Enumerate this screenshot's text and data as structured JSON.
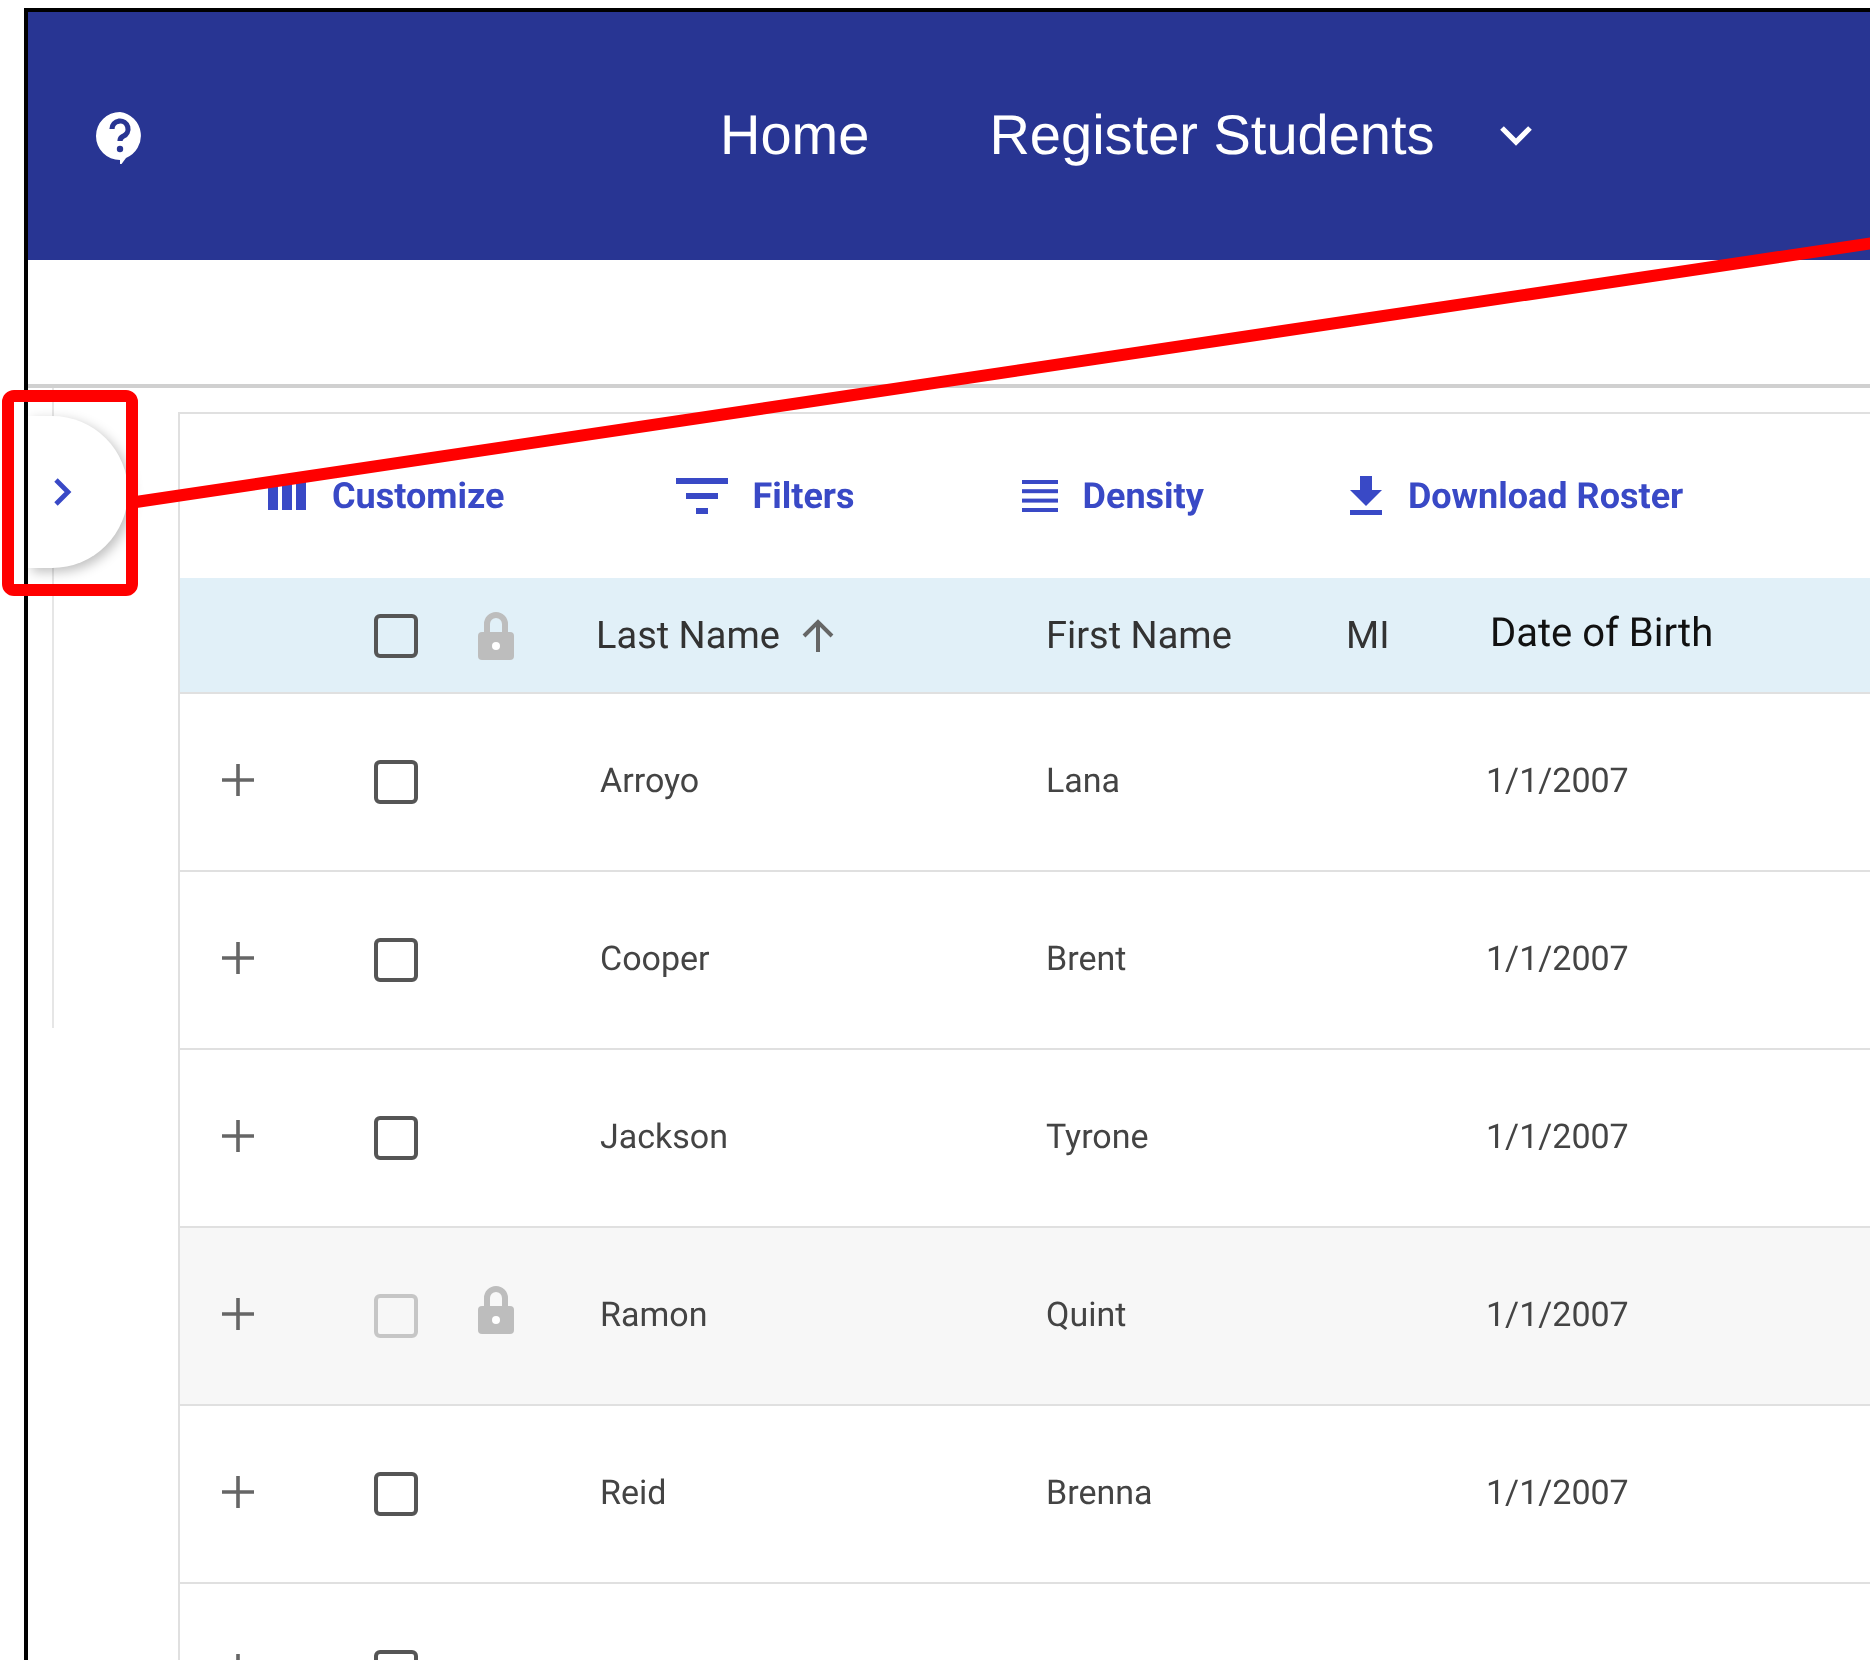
{
  "header": {
    "nav": [
      {
        "label": "Home",
        "kind": "link"
      },
      {
        "label": "Register Students",
        "kind": "dropdown"
      }
    ]
  },
  "sidebar_toggle": {
    "expanded": false
  },
  "toolbar": [
    {
      "label": "Customize",
      "kind": "columns"
    },
    {
      "label": "Filters",
      "kind": "filter"
    },
    {
      "label": "Density",
      "kind": "density"
    },
    {
      "label": "Download Roster",
      "kind": "download"
    }
  ],
  "table": {
    "select_all": {
      "checked": false
    },
    "columns": [
      {
        "label": "Last Name",
        "sorted_ascending": true
      },
      {
        "label": "First Name",
        "sorted_ascending": false
      },
      {
        "label": "MI",
        "sorted_ascending": false
      },
      {
        "label": "Date of Birth",
        "sorted_ascending": false
      }
    ],
    "rows": [
      {
        "last_name": "Arroyo",
        "first_name": "Lana",
        "date_of_birth": "1/1/2007",
        "locked": false,
        "checked": false
      },
      {
        "last_name": "Cooper",
        "first_name": "Brent",
        "date_of_birth": "1/1/2007",
        "locked": false,
        "checked": false
      },
      {
        "last_name": "Jackson",
        "first_name": "Tyrone",
        "date_of_birth": "1/1/2007",
        "locked": false,
        "checked": false
      },
      {
        "last_name": "Ramon",
        "first_name": "Quint",
        "date_of_birth": "1/1/2007",
        "locked": true,
        "checked": false
      },
      {
        "last_name": "Reid",
        "first_name": "Brenna",
        "date_of_birth": "1/1/2007",
        "locked": false,
        "checked": false
      },
      {
        "locked": false,
        "checked": false
      }
    ]
  },
  "annotation": {
    "kind": "callout"
  }
}
